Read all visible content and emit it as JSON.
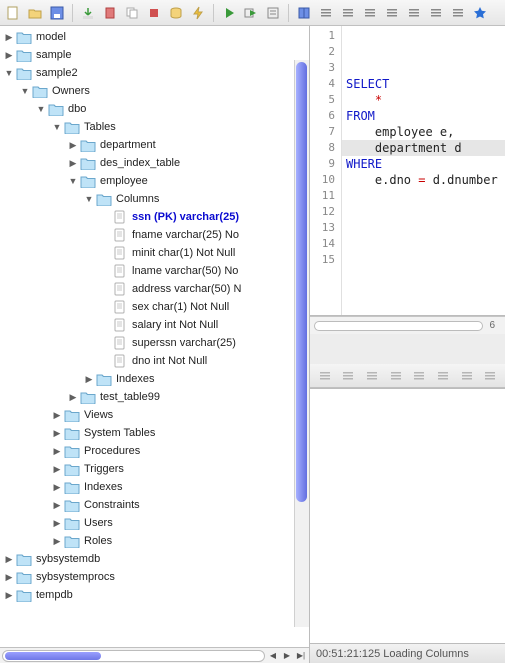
{
  "toolbar": {
    "buttons": [
      "new-icon",
      "open-icon",
      "save-icon",
      "sep",
      "import-icon",
      "drop-icon",
      "copy-object-icon",
      "stop-icon",
      "database-icon",
      "lightning-icon",
      "sep",
      "execute-icon",
      "execute-selection-icon",
      "format-icon",
      "sep",
      "book-icon",
      "align-left-icon",
      "align-center-icon",
      "align-right-icon",
      "indent-icon",
      "outdent-icon",
      "wand-icon",
      "palette-icon",
      "star-icon"
    ]
  },
  "tree": [
    {
      "label": "model",
      "icon": "folder",
      "collapsed": true,
      "depth": 0
    },
    {
      "label": "sample",
      "icon": "folder",
      "collapsed": true,
      "depth": 0
    },
    {
      "label": "sample2",
      "icon": "folder",
      "collapsed": false,
      "depth": 0
    },
    {
      "label": "Owners",
      "icon": "folder",
      "collapsed": false,
      "depth": 1
    },
    {
      "label": "dbo",
      "icon": "folder",
      "collapsed": false,
      "depth": 2
    },
    {
      "label": "Tables",
      "icon": "folder",
      "collapsed": false,
      "depth": 3
    },
    {
      "label": "department",
      "icon": "folder",
      "collapsed": true,
      "depth": 4
    },
    {
      "label": "des_index_table",
      "icon": "folder",
      "collapsed": true,
      "depth": 4
    },
    {
      "label": "employee",
      "icon": "folder",
      "collapsed": false,
      "depth": 4
    },
    {
      "label": "Columns",
      "icon": "folder",
      "collapsed": false,
      "depth": 5
    },
    {
      "label": "ssn (PK) varchar(25)",
      "icon": "leaf",
      "depth": 6,
      "pk": true
    },
    {
      "label": "fname varchar(25) No",
      "icon": "leaf",
      "depth": 6
    },
    {
      "label": "minit char(1) Not Null",
      "icon": "leaf",
      "depth": 6
    },
    {
      "label": "lname varchar(50) No",
      "icon": "leaf",
      "depth": 6
    },
    {
      "label": "address varchar(50) N",
      "icon": "leaf",
      "depth": 6
    },
    {
      "label": "sex char(1) Not Null",
      "icon": "leaf",
      "depth": 6
    },
    {
      "label": "salary int Not Null",
      "icon": "leaf",
      "depth": 6
    },
    {
      "label": "superssn varchar(25)",
      "icon": "leaf",
      "depth": 6
    },
    {
      "label": "dno int Not Null",
      "icon": "leaf",
      "depth": 6
    },
    {
      "label": "Indexes",
      "icon": "folder",
      "collapsed": true,
      "depth": 5
    },
    {
      "label": "test_table99",
      "icon": "folder",
      "collapsed": true,
      "depth": 4
    },
    {
      "label": "Views",
      "icon": "folder",
      "collapsed": true,
      "depth": 3
    },
    {
      "label": "System Tables",
      "icon": "folder",
      "collapsed": true,
      "depth": 3
    },
    {
      "label": "Procedures",
      "icon": "folder",
      "collapsed": true,
      "depth": 3
    },
    {
      "label": "Triggers",
      "icon": "folder",
      "collapsed": true,
      "depth": 3
    },
    {
      "label": "Indexes",
      "icon": "folder",
      "collapsed": true,
      "depth": 3
    },
    {
      "label": "Constraints",
      "icon": "folder",
      "collapsed": true,
      "depth": 3
    },
    {
      "label": "Users",
      "icon": "folder",
      "collapsed": true,
      "depth": 3
    },
    {
      "label": "Roles",
      "icon": "folder",
      "collapsed": true,
      "depth": 3
    },
    {
      "label": "sybsystemdb",
      "icon": "folder",
      "collapsed": true,
      "depth": 0
    },
    {
      "label": "sybsystemprocs",
      "icon": "folder",
      "collapsed": true,
      "depth": 0
    },
    {
      "label": "tempdb",
      "icon": "folder",
      "collapsed": true,
      "depth": 0
    }
  ],
  "editor": {
    "line_count": 15,
    "current_line": 8,
    "code_lines": [
      {
        "t": "kw",
        "v": "SELECT"
      },
      {
        "t": "op",
        "v": "    *"
      },
      {
        "t": "kw",
        "v": "FROM"
      },
      {
        "t": "plain",
        "v": "    employee e,"
      },
      {
        "t": "plain",
        "v": "    department d"
      },
      {
        "t": "kw",
        "v": "WHERE"
      },
      {
        "t": "mix",
        "v": "    e.dno = d.dnumber"
      },
      {
        "t": "plain",
        "v": ""
      },
      {
        "t": "plain",
        "v": ""
      },
      {
        "t": "plain",
        "v": ""
      },
      {
        "t": "plain",
        "v": ""
      },
      {
        "t": "plain",
        "v": ""
      },
      {
        "t": "plain",
        "v": ""
      },
      {
        "t": "plain",
        "v": ""
      },
      {
        "t": "plain",
        "v": ""
      }
    ],
    "hscroll_label": "6"
  },
  "mini_toolbar": {
    "buttons": [
      "refresh-icon",
      "nav-back-icon",
      "rows-icon",
      "nav-fwd-icon",
      "indent-left-icon",
      "indent-right-icon",
      "copy-icon",
      "paste-icon"
    ]
  },
  "statusbar": {
    "text": "00:51:21:125 Loading Columns"
  }
}
